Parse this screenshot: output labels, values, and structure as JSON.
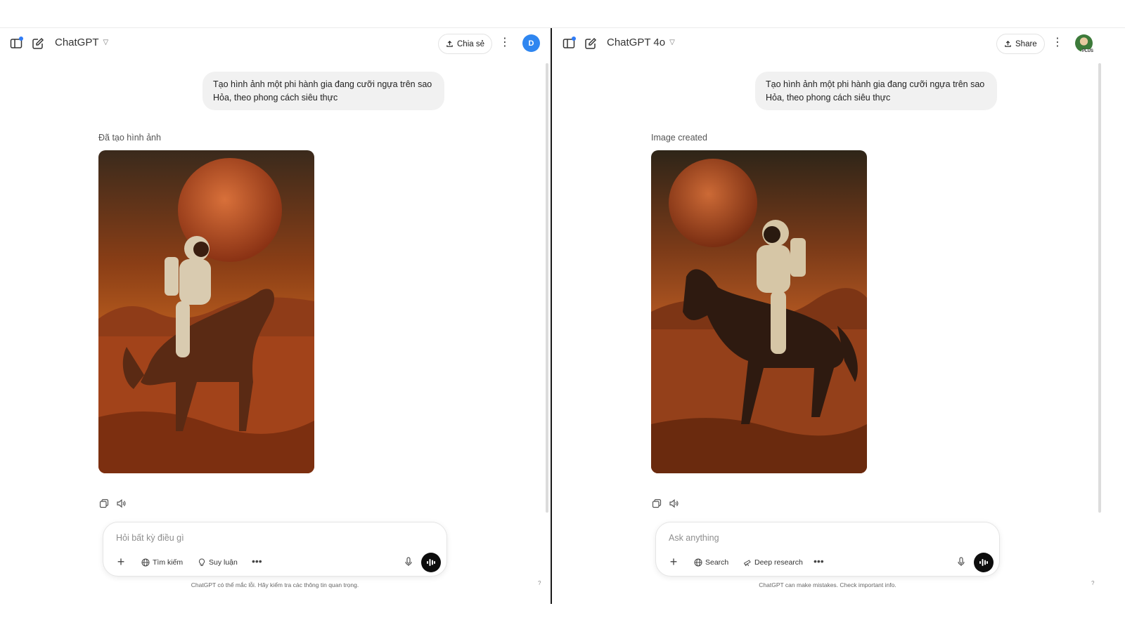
{
  "left": {
    "model_name": "ChatGPT",
    "share_label": "Chia sẻ",
    "avatar_initial": "D",
    "user_message": "Tạo hình ảnh một phi hành gia đang cưỡi ngựa trên sao Hỏa, theo phong cách siêu thực",
    "created_label": "Đã tạo hình ảnh",
    "composer": {
      "placeholder": "Hỏi bất kỳ điều gì",
      "tool_search": "Tìm kiếm",
      "tool_reason": "Suy luận"
    },
    "disclaimer": "ChatGPT có thể mắc lỗi. Hãy kiểm tra các thông tin quan trọng.",
    "help": "?"
  },
  "right": {
    "model_name": "ChatGPT 4o",
    "share_label": "Share",
    "avatar_badge": "PLUS",
    "user_message": "Tạo hình ảnh một phi hành gia đang cưỡi ngựa trên sao Hỏa, theo phong cách siêu thực",
    "created_label": "Image created",
    "composer": {
      "placeholder": "Ask anything",
      "tool_search": "Search",
      "tool_research": "Deep research"
    },
    "disclaimer": "ChatGPT can make mistakes. Check important info.",
    "help": "?"
  },
  "colors": {
    "accent_blue": "#2f86f0",
    "bubble_bg": "#f1f1f1",
    "mars_sky": "#b8501d",
    "mars_ground": "#9c3a12"
  },
  "icons": {
    "sidebar": "sidebar-toggle-icon",
    "new_chat": "new-chat-icon",
    "share": "upload-icon",
    "copy": "copy-icon",
    "read_aloud": "speaker-icon",
    "globe": "globe-icon",
    "bulb": "lightbulb-icon",
    "telescope": "telescope-icon",
    "mic": "mic-icon",
    "voice": "voice-mode-icon"
  }
}
